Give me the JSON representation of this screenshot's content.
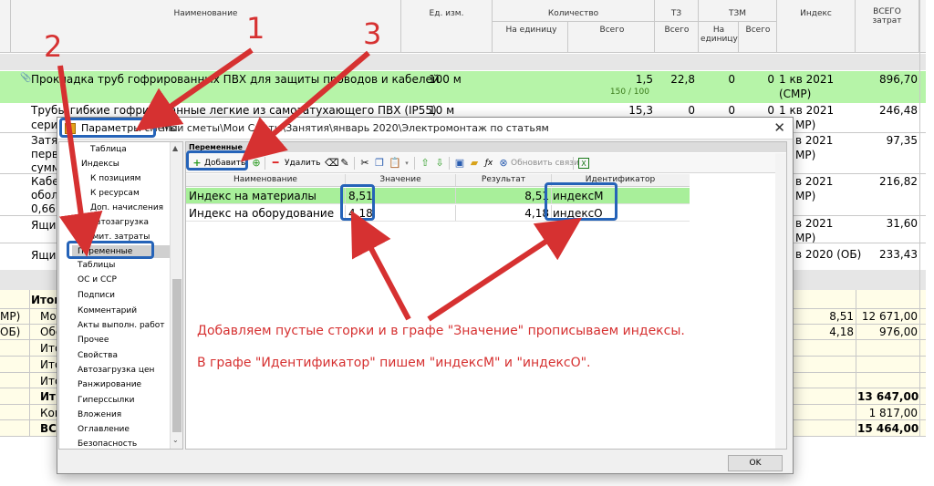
{
  "sheet": {
    "headers": {
      "name": "Наименование",
      "unit": "Ед. изм.",
      "quantity": "Количество",
      "qty_per_unit": "На единицу",
      "qty_total": "Всего",
      "tz": "ТЗ",
      "tz_total": "Всего",
      "tzm": "ТЗМ",
      "tzm_per_unit_1": "На",
      "tzm_per_unit_2": "единицу",
      "tzm_total": "Всего",
      "index": "Индекс",
      "total_costs_1": "ВСЕГО",
      "total_costs_2": "затрат"
    },
    "rows": [
      {
        "name": "Прокладка труб гофрированных ПВХ для защиты проводов и кабелей",
        "unit": "100 м",
        "qty_total": "1,5",
        "qty_sub": "150 / 100",
        "tz": "22,8",
        "tzm_unit": "0",
        "tzm_total": "0",
        "index": "1 кв 2021",
        "index2": "(СМР)",
        "cost": "896,70"
      },
      {
        "name": "Трубы гибкие гофрированные легкие из самозатухающего ПВХ (IP55)",
        "name2": "сери",
        "unit": "10 м",
        "qty_total": "15,3",
        "tz": "0",
        "tzm_unit": "0",
        "tzm_total": "0",
        "index": "1 кв 2021",
        "index2": "МР)",
        "cost": "246,48"
      },
      {
        "name": "Затя",
        "name2": "перв",
        "name3": "сумм",
        "index": "в 2021",
        "index2": "МР)",
        "cost": "97,35"
      },
      {
        "name": "Кабе",
        "name2": "обол",
        "name3": "0,66",
        "index": "в 2021",
        "index2": "МР)",
        "cost": "216,82"
      },
      {
        "name": "Ящи",
        "index": "в 2021",
        "index2": "МР)",
        "cost": "31,60"
      },
      {
        "name": "Ящи",
        "index": "в 2020 (ОБ)",
        "cost": "233,43"
      }
    ],
    "totals": {
      "itog": "Итог",
      "mo": "Мо",
      "mo_prefix": "МР)",
      "mo_index": "8,51",
      "mo_cost": "12 671,00",
      "obo": "Обо",
      "obo_prefix": "ОБ)",
      "obo_index": "4,18",
      "obo_cost": "976,00",
      "itg1": "Итог",
      "itg2": "Итог",
      "itg3": "Итог",
      "it_bold": "Ит",
      "sum1": "13 647,00",
      "kom": "Ком",
      "sum2": "1 817,00",
      "vs": "ВС",
      "sum3": "15 464,00"
    }
  },
  "dialog": {
    "title": "Параметры сметы",
    "path": "Мои сметы\\Мои Сметы\\Занятия\\январь 2020\\Электромонтаж по статьям",
    "close": "✕",
    "nav": [
      "Таблица",
      "Индексы",
      "К позициям",
      "К ресурсам",
      "Доп. начисления",
      "Автозагрузка",
      "Лимит. затраты",
      "Переменные",
      "Таблицы",
      "ОС и ССР",
      "Подписи",
      "Комментарий",
      "Акты выполн. работ",
      "Прочее",
      "Свойства",
      "Автозагрузка цен",
      "Ранжирование",
      "Гиперссылки",
      "Вложения",
      "Оглавление",
      "Безопасность"
    ],
    "panel_title": "Переменные",
    "toolbar": {
      "add": "Добавить",
      "delete": "Удалить",
      "refresh_links": "Обновить связи"
    },
    "grid": {
      "headers": [
        "Наименование",
        "Значение",
        "Результат",
        "Идентификатор"
      ],
      "rows": [
        {
          "name": "Индекс на материалы",
          "value": "8,51",
          "result": "8,51",
          "id": "индексМ"
        },
        {
          "name": "Индекс на оборудование",
          "value": "4,18",
          "result": "4,18",
          "id": "индексО"
        }
      ]
    },
    "ok": "OK"
  },
  "annotations": {
    "n1": "1",
    "n2": "2",
    "n3": "3",
    "text1": "Добавляем пустые сторки и в графе \"Значение\" прописываем индексы.",
    "text2": "В графе \"Идентификатор\" пишем \"индексМ\" и \"индексО\"."
  },
  "colors": {
    "green_row": "#b6f4a8",
    "annotation_red": "#d63131",
    "highlight_blue": "#2563b8"
  }
}
